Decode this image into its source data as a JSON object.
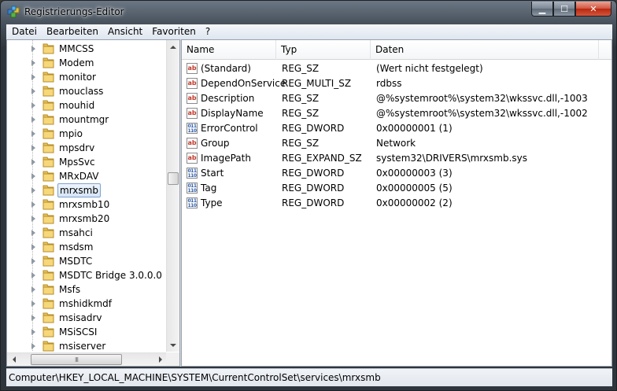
{
  "window": {
    "title": "Registrierungs-Editor"
  },
  "caption_buttons": {
    "minimize": "▁",
    "maximize": "☐",
    "close": "✕"
  },
  "menu": [
    "Datei",
    "Bearbeiten",
    "Ansicht",
    "Favoriten",
    "?"
  ],
  "tree": {
    "items": [
      {
        "label": "MMCSS",
        "selected": false
      },
      {
        "label": "Modem",
        "selected": false
      },
      {
        "label": "monitor",
        "selected": false
      },
      {
        "label": "mouclass",
        "selected": false
      },
      {
        "label": "mouhid",
        "selected": false
      },
      {
        "label": "mountmgr",
        "selected": false
      },
      {
        "label": "mpio",
        "selected": false
      },
      {
        "label": "mpsdrv",
        "selected": false
      },
      {
        "label": "MpsSvc",
        "selected": false
      },
      {
        "label": "MRxDAV",
        "selected": false
      },
      {
        "label": "mrxsmb",
        "selected": true
      },
      {
        "label": "mrxsmb10",
        "selected": false
      },
      {
        "label": "mrxsmb20",
        "selected": false
      },
      {
        "label": "msahci",
        "selected": false
      },
      {
        "label": "msdsm",
        "selected": false
      },
      {
        "label": "MSDTC",
        "selected": false
      },
      {
        "label": "MSDTC Bridge 3.0.0.0",
        "selected": false
      },
      {
        "label": "Msfs",
        "selected": false
      },
      {
        "label": "mshidkmdf",
        "selected": false
      },
      {
        "label": "msisadrv",
        "selected": false
      },
      {
        "label": "MSiSCSI",
        "selected": false
      },
      {
        "label": "msiserver",
        "selected": false
      }
    ],
    "hscroll_thumb_glyph": "III"
  },
  "list": {
    "headers": {
      "name": "Name",
      "type": "Typ",
      "data": "Daten"
    },
    "rows": [
      {
        "icon": "string-value-icon",
        "icon_text": "ab",
        "name": "(Standard)",
        "type": "REG_SZ",
        "data": "(Wert nicht festgelegt)"
      },
      {
        "icon": "string-value-icon",
        "icon_text": "ab",
        "name": "DependOnService",
        "type": "REG_MULTI_SZ",
        "data": "rdbss"
      },
      {
        "icon": "string-value-icon",
        "icon_text": "ab",
        "name": "Description",
        "type": "REG_SZ",
        "data": "@%systemroot%\\system32\\wkssvc.dll,-1003"
      },
      {
        "icon": "string-value-icon",
        "icon_text": "ab",
        "name": "DisplayName",
        "type": "REG_SZ",
        "data": "@%systemroot%\\system32\\wkssvc.dll,-1002"
      },
      {
        "icon": "binary-value-icon",
        "icon_text": "011 110",
        "name": "ErrorControl",
        "type": "REG_DWORD",
        "data": "0x00000001 (1)"
      },
      {
        "icon": "string-value-icon",
        "icon_text": "ab",
        "name": "Group",
        "type": "REG_SZ",
        "data": "Network"
      },
      {
        "icon": "string-value-icon",
        "icon_text": "ab",
        "name": "ImagePath",
        "type": "REG_EXPAND_SZ",
        "data": "system32\\DRIVERS\\mrxsmb.sys"
      },
      {
        "icon": "binary-value-icon",
        "icon_text": "011 110",
        "name": "Start",
        "type": "REG_DWORD",
        "data": "0x00000003 (3)"
      },
      {
        "icon": "binary-value-icon",
        "icon_text": "011 110",
        "name": "Tag",
        "type": "REG_DWORD",
        "data": "0x00000005 (5)"
      },
      {
        "icon": "binary-value-icon",
        "icon_text": "011 110",
        "name": "Type",
        "type": "REG_DWORD",
        "data": "0x00000002 (2)"
      }
    ]
  },
  "statusbar": {
    "path": "Computer\\HKEY_LOCAL_MACHINE\\SYSTEM\\CurrentControlSet\\services\\mrxsmb"
  }
}
